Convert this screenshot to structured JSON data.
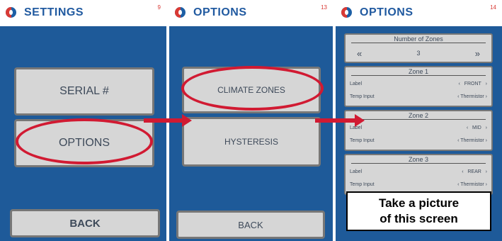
{
  "screen1": {
    "title": "SETTINGS",
    "page_number": "9",
    "buttons": [
      "SERIAL #",
      "OPTIONS"
    ],
    "back": "BACK"
  },
  "screen2": {
    "title": "OPTIONS",
    "page_number": "13",
    "buttons": [
      "CLIMATE ZONES",
      "HYSTERESIS"
    ],
    "back": "BACK"
  },
  "screen3": {
    "title": "OPTIONS",
    "page_number": "14",
    "num_zones": {
      "title": "Number of Zones",
      "value": "3",
      "left": "«",
      "right": "»"
    },
    "zones": [
      {
        "title": "Zone 1",
        "label_text": "Label",
        "label_value": "FRONT",
        "temp_text": "Temp Input",
        "temp_value": "Thermistor"
      },
      {
        "title": "Zone 2",
        "label_text": "Label",
        "label_value": "MID",
        "temp_text": "Temp Input",
        "temp_value": "Thermistor"
      },
      {
        "title": "Zone 3",
        "label_text": "Label",
        "label_value": "REAR",
        "temp_text": "Temp Input",
        "temp_value": "Thermistor"
      }
    ]
  },
  "callout": {
    "line1": "Take a picture",
    "line2": "of this screen"
  },
  "colors": {
    "header_text": "#215aa0",
    "panel_bg": "#1e5a99",
    "highlight": "#d11a32",
    "button_bg": "#d6d6d6"
  }
}
